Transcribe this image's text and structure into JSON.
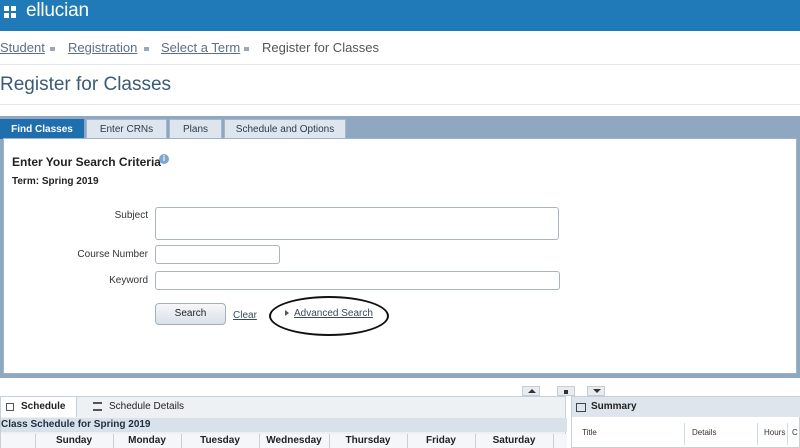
{
  "app": {
    "brand": "ellucian"
  },
  "breadcrumb": {
    "items": [
      "Student",
      "Registration",
      "Select a Term",
      "Register for Classes"
    ]
  },
  "page": {
    "title": "Register for Classes"
  },
  "tabs": [
    "Find Classes",
    "Enter CRNs",
    "Plans",
    "Schedule and Options"
  ],
  "search": {
    "heading": "Enter Your Search Criteria",
    "term": "Term: Spring 2019",
    "subject_label": "Subject",
    "course_number_label": "Course Number",
    "keyword_label": "Keyword",
    "subject_value": "",
    "course_number_value": "",
    "keyword_value": "",
    "search_button": "Search",
    "clear_link": "Clear",
    "advanced_link": "Advanced Search"
  },
  "schedule": {
    "tabs": [
      "Schedule",
      "Schedule Details"
    ],
    "title": "Class Schedule for Spring 2019",
    "days": [
      "Sunday",
      "Monday",
      "Tuesday",
      "Wednesday",
      "Thursday",
      "Friday",
      "Saturday"
    ]
  },
  "summary": {
    "title": "Summary",
    "columns": [
      "Title",
      "Details",
      "Hours",
      "C"
    ]
  },
  "colors": {
    "topbar": "#1f7ab7",
    "active_tab": "#1f6fae",
    "panel_frame": "#8fa7c0"
  },
  "icons": {
    "grid": "grid-icon",
    "info": "info-icon",
    "calendar": "calendar-icon",
    "list": "list-icon"
  }
}
